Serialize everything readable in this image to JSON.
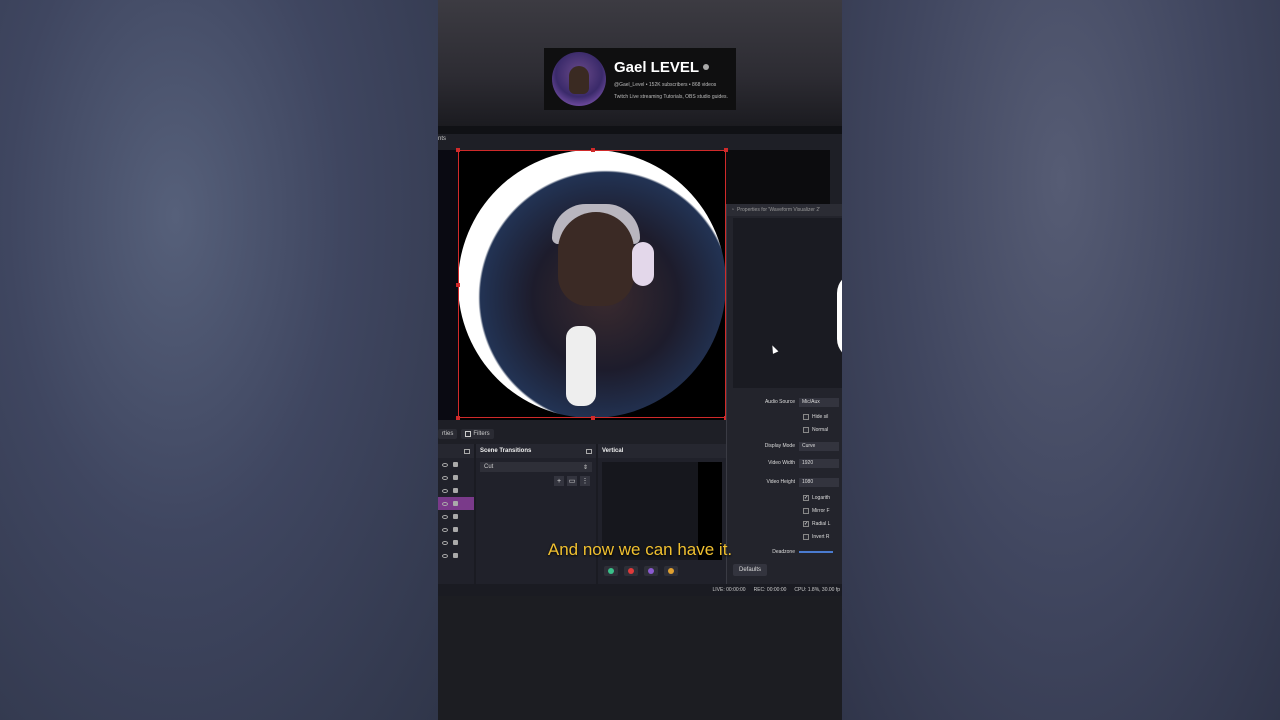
{
  "channel": {
    "name": "Gael LEVEL",
    "stats": "@Gael_Level • 152K subscribers • 868 videos",
    "description": "Twitch Live streaming Tutorials, OBS studio guides."
  },
  "obs": {
    "title_fragment": "nts",
    "toolbar": {
      "properties_label": "rties",
      "filters_label": "Filters"
    },
    "docks": {
      "scene_transitions": "Scene Transitions",
      "transition_value": "Cut",
      "vertical": "Vertical"
    },
    "properties": {
      "title": "Properties for 'Waveform Visualizer 2'",
      "audio_source_label": "Audio Source",
      "audio_source_value": "Mic/Aux",
      "hide_label": "Hide sil",
      "normalize_label": "Normal",
      "display_mode_label": "Display Mode",
      "display_mode_value": "Curve",
      "video_width_label": "Video Width",
      "video_width_value": "1920",
      "video_height_label": "Video Height",
      "video_height_value": "1080",
      "log_label": "Logarith",
      "mirror_label": "Mirror F",
      "radial_label": "Radial L",
      "invert_label": "Invert R",
      "deadzone_label": "Deadzone",
      "defaults_label": "Defaults",
      "checks": {
        "hide": false,
        "normalize": false,
        "log": true,
        "mirror": false,
        "radial": true,
        "invert": false
      }
    },
    "status": {
      "live": "LIVE: 00:00:00",
      "rec": "REC: 00:00:00",
      "cpu": "CPU: 1.8%, 30.00 fp"
    }
  },
  "caption": "And now we can have it.",
  "colors": {
    "caption": "#f0c030",
    "selection": "#d02a2a",
    "selected_source": "#7a3a8a"
  }
}
